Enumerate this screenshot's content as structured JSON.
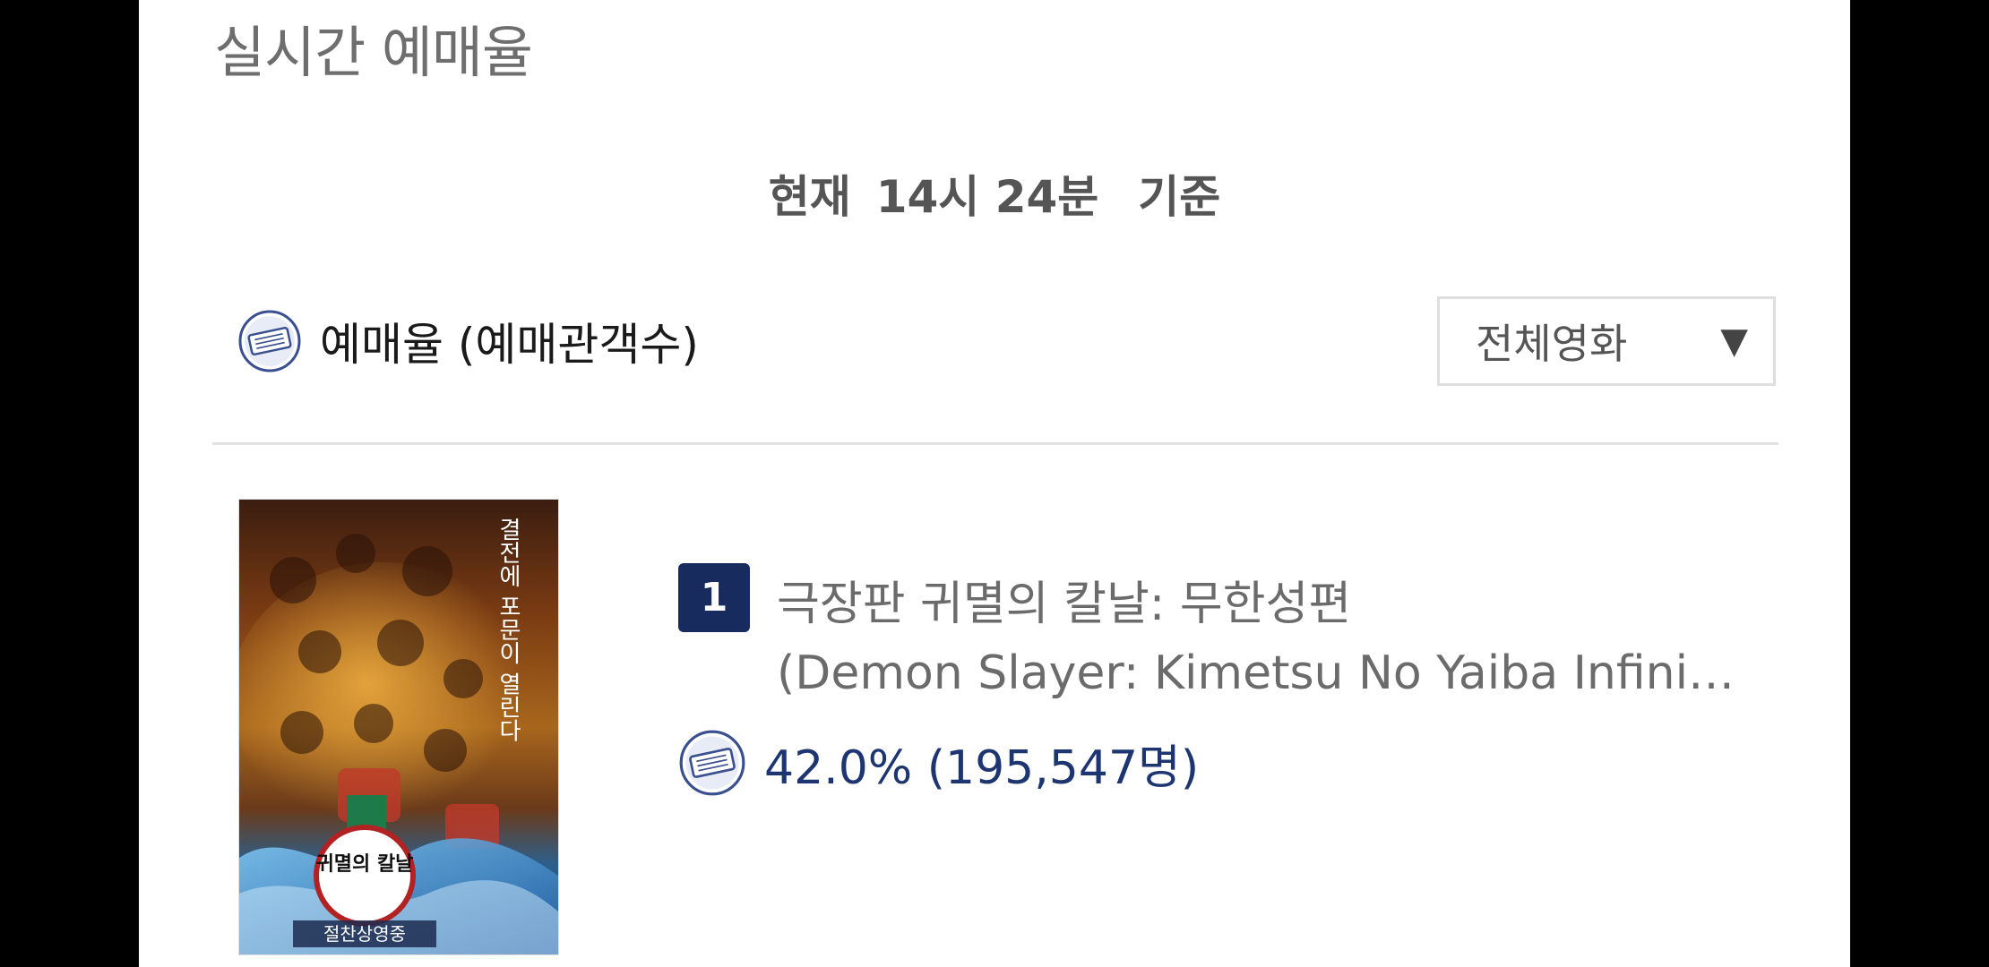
{
  "header": {
    "title": "실시간 예매율"
  },
  "updated": {
    "prefix": "현재",
    "time": "14시 24분",
    "suffix": "기준"
  },
  "legend": {
    "icon": "ticket-icon",
    "label": "예매율 (예매관객수)"
  },
  "filter": {
    "selected": "전체영화",
    "arrow": "▼"
  },
  "colors": {
    "accent_navy": "#172b5e",
    "rate_text": "#1d3570",
    "icon_blue": "#3a4f8f"
  },
  "movies": [
    {
      "rank": "1",
      "title": "극장판 귀멸의 칼날: 무한성편",
      "subtitle": "(Demon Slayer: Kimetsu No Yaiba Infinity Castle)",
      "rate": "42.0% (195,547명)",
      "poster": {
        "side_text": "결전에 포문이 열린다",
        "logo_text": "귀멸의 칼날",
        "bottom_text": "절찬상영중"
      }
    }
  ]
}
